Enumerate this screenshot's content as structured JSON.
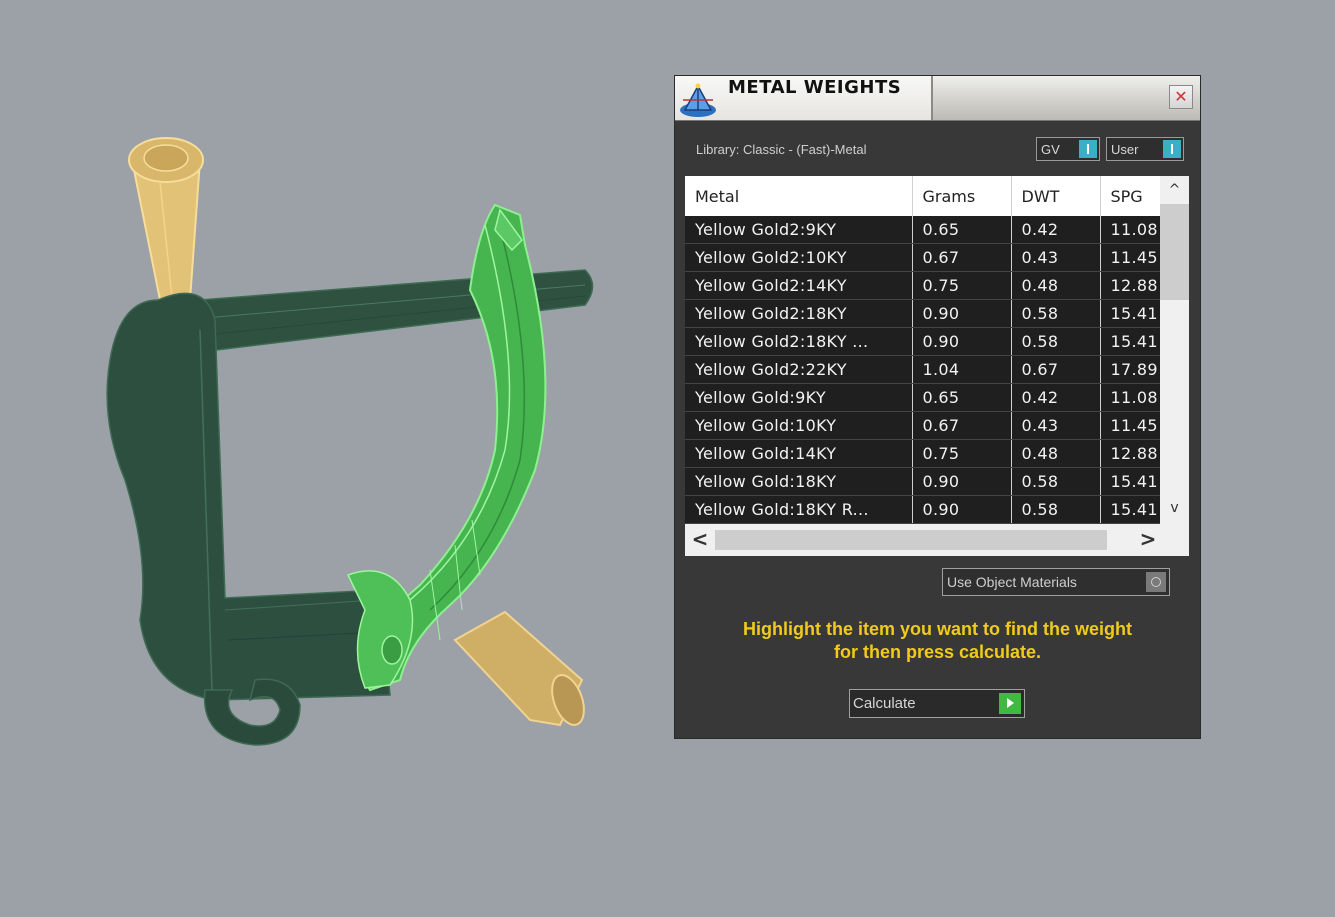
{
  "panel": {
    "title": "METAL WEIGHTS",
    "close_glyph": "✕",
    "library_label": "Library: Classic - (Fast)-Metal",
    "toggles": {
      "gv": "GV",
      "user": "User"
    },
    "columns": [
      "Metal",
      "Grams",
      "DWT",
      "SPG"
    ],
    "rows": [
      [
        "Yellow Gold2:9KY",
        "0.65",
        "0.42",
        "11.08"
      ],
      [
        "Yellow Gold2:10KY",
        "0.67",
        "0.43",
        "11.45"
      ],
      [
        "Yellow Gold2:14KY",
        "0.75",
        "0.48",
        "12.88"
      ],
      [
        "Yellow Gold2:18KY",
        "0.90",
        "0.58",
        "15.41"
      ],
      [
        "Yellow Gold2:18KY ...",
        "0.90",
        "0.58",
        "15.41"
      ],
      [
        "Yellow Gold2:22KY",
        "1.04",
        "0.67",
        "17.89"
      ],
      [
        "Yellow Gold:9KY",
        "0.65",
        "0.42",
        "11.08"
      ],
      [
        "Yellow Gold:10KY",
        "0.67",
        "0.43",
        "11.45"
      ],
      [
        "Yellow Gold:14KY",
        "0.75",
        "0.48",
        "12.88"
      ],
      [
        "Yellow Gold:18KY",
        "0.90",
        "0.58",
        "15.41"
      ],
      [
        "Yellow Gold:18KY R...",
        "0.90",
        "0.58",
        "15.41"
      ]
    ],
    "scroll_glyphs": {
      "up": "^",
      "down": "v",
      "left": "<",
      "right": ">"
    },
    "use_object_materials": "Use Object Materials",
    "hint": [
      "Highlight the item you want to find the weight",
      "for then press calculate."
    ],
    "calculate_label": "Calculate"
  },
  "colors": {
    "viewport_bg": "#9ca1a8",
    "panel_bg": "#383838",
    "hint_text": "#f0cb1c",
    "selected_part": "#4cc45a",
    "model_body": "#2f5240",
    "prong": "#e6c67a"
  }
}
